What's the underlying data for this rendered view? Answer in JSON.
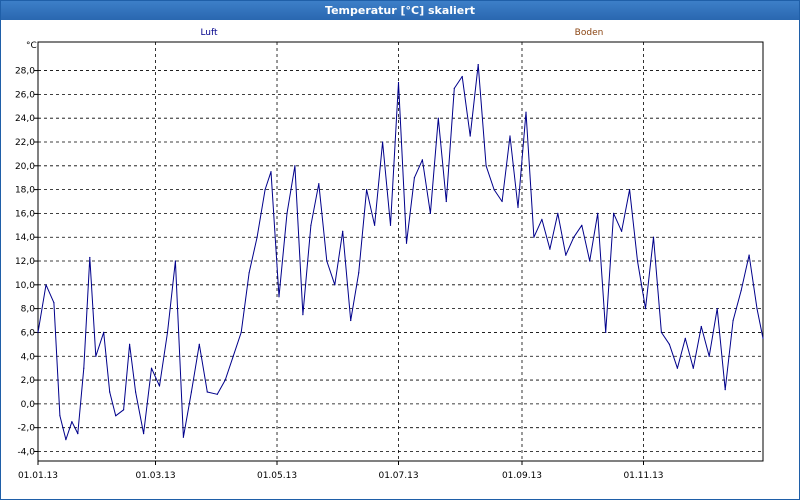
{
  "window": {
    "title": "Temperatur [°C] skaliert"
  },
  "chart_data": {
    "type": "line",
    "title": "Temperatur [°C] skaliert",
    "ylabel": "°C",
    "xlabel": "",
    "ylim": [
      -4.8,
      30.4
    ],
    "xlim": [
      "2013-01-01",
      "2013-12-31"
    ],
    "grid": true,
    "legend_placement": "top",
    "yticks": [
      "-4,0",
      "-2,0",
      "0,0",
      "2,0",
      "4,0",
      "6,0",
      "8,0",
      "10,0",
      "12,0",
      "14,0",
      "16,0",
      "18,0",
      "20,0",
      "22,0",
      "24,0",
      "26,0",
      "28,0"
    ],
    "xticks": [
      "01.01.13",
      "01.03.13",
      "01.05.13",
      "01.07.13",
      "01.09.13",
      "01.11.13"
    ],
    "legend": [
      {
        "name": "Luft",
        "color": "#00008b"
      },
      {
        "name": "Boden",
        "color": "#8b4513"
      }
    ],
    "series": [
      {
        "name": "Luft",
        "color": "#00008b",
        "x": [
          "2013-01-01",
          "2013-01-05",
          "2013-01-09",
          "2013-01-12",
          "2013-01-15",
          "2013-01-18",
          "2013-01-21",
          "2013-01-24",
          "2013-01-27",
          "2013-01-30",
          "2013-02-03",
          "2013-02-06",
          "2013-02-09",
          "2013-02-13",
          "2013-02-16",
          "2013-02-19",
          "2013-02-23",
          "2013-02-27",
          "2013-03-03",
          "2013-03-07",
          "2013-03-11",
          "2013-03-15",
          "2013-03-19",
          "2013-03-23",
          "2013-03-27",
          "2013-04-01",
          "2013-04-05",
          "2013-04-09",
          "2013-04-13",
          "2013-04-17",
          "2013-04-21",
          "2013-04-25",
          "2013-04-28",
          "2013-05-02",
          "2013-05-06",
          "2013-05-10",
          "2013-05-14",
          "2013-05-18",
          "2013-05-22",
          "2013-05-26",
          "2013-05-30",
          "2013-06-03",
          "2013-06-07",
          "2013-06-11",
          "2013-06-15",
          "2013-06-19",
          "2013-06-23",
          "2013-06-27",
          "2013-07-01",
          "2013-07-05",
          "2013-07-09",
          "2013-07-13",
          "2013-07-17",
          "2013-07-21",
          "2013-07-25",
          "2013-07-29",
          "2013-08-02",
          "2013-08-06",
          "2013-08-10",
          "2013-08-14",
          "2013-08-18",
          "2013-08-22",
          "2013-08-26",
          "2013-08-30",
          "2013-09-03",
          "2013-09-07",
          "2013-09-11",
          "2013-09-15",
          "2013-09-19",
          "2013-09-23",
          "2013-09-27",
          "2013-10-01",
          "2013-10-05",
          "2013-10-09",
          "2013-10-13",
          "2013-10-17",
          "2013-10-21",
          "2013-10-25",
          "2013-10-29",
          "2013-11-02",
          "2013-11-06",
          "2013-11-10",
          "2013-11-14",
          "2013-11-18",
          "2013-11-22",
          "2013-11-26",
          "2013-11-30",
          "2013-12-04",
          "2013-12-08",
          "2013-12-12",
          "2013-12-16",
          "2013-12-20",
          "2013-12-24",
          "2013-12-28",
          "2013-12-31"
        ],
        "values": [
          6.0,
          10.0,
          8.5,
          -1.0,
          -3.0,
          -1.5,
          -2.5,
          3.0,
          12.3,
          4.0,
          6.0,
          1.0,
          -1.0,
          -0.5,
          5.0,
          1.0,
          -2.5,
          3.0,
          1.5,
          6.0,
          12.0,
          -2.8,
          1.0,
          5.0,
          1.0,
          0.8,
          2.0,
          4.0,
          6.0,
          11.0,
          14.0,
          18.0,
          19.5,
          9.0,
          16.0,
          20.0,
          7.5,
          15.0,
          18.5,
          12.0,
          10.0,
          14.5,
          7.0,
          11.0,
          18.0,
          15.0,
          22.0,
          15.0,
          27.0,
          13.5,
          19.0,
          20.5,
          16.0,
          24.0,
          17.0,
          26.5,
          27.5,
          22.5,
          28.5,
          20.0,
          18.0,
          17.0,
          22.5,
          16.5,
          24.5,
          14.0,
          15.5,
          13.0,
          16.0,
          12.5,
          14.0,
          15.0,
          12.0,
          16.0,
          6.0,
          16.0,
          14.5,
          18.0,
          12.0,
          8.0,
          14.0,
          6.0,
          5.0,
          3.0,
          5.5,
          3.0,
          6.5,
          4.0,
          8.0,
          1.2,
          7.0,
          9.5,
          12.5,
          8.0,
          5.5
        ]
      }
    ]
  }
}
